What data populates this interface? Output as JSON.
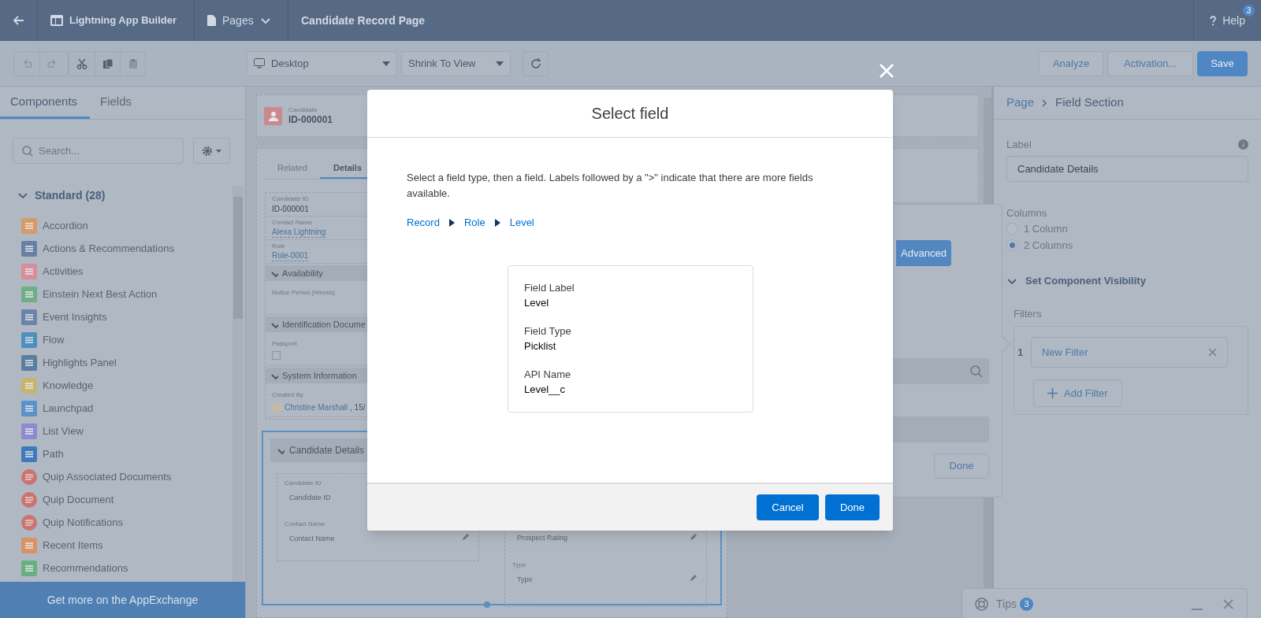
{
  "top_bar": {
    "app_name": "Lightning App Builder",
    "pages_menu": "Pages",
    "page_title": "Candidate Record Page",
    "help": {
      "label": "Help",
      "badge": "3"
    }
  },
  "toolbar": {
    "device": "Desktop",
    "zoom": "Shrink To View",
    "buttons": [
      {
        "label": "Analyze",
        "kind": "neutral"
      },
      {
        "label": "Activation...",
        "kind": "neutral"
      },
      {
        "label": "Save",
        "kind": "brand"
      }
    ]
  },
  "left_panel": {
    "tabs": [
      {
        "label": "Components",
        "selected": true
      },
      {
        "label": "Fields",
        "selected": false
      }
    ],
    "search": {
      "placeholder": "Search..."
    },
    "group": {
      "label": "Standard (28)",
      "expanded": true
    },
    "components": [
      {
        "label": "Accordion",
        "kind": "tile",
        "color": "#d59a65"
      },
      {
        "label": "Actions & Recommendations",
        "kind": "tile",
        "color": "#6a7fa6"
      },
      {
        "label": "Activities",
        "kind": "tile",
        "color": "#d88d9a"
      },
      {
        "label": "Einstein Next Best Action",
        "kind": "tile",
        "color": "#6fae86"
      },
      {
        "label": "Event Insights",
        "kind": "tile",
        "color": "#6b84aa"
      },
      {
        "label": "Flow",
        "kind": "tile",
        "color": "#4d8fbd"
      },
      {
        "label": "Highlights Panel",
        "kind": "tile",
        "color": "#5a7e9e"
      },
      {
        "label": "Knowledge",
        "kind": "tile",
        "color": "#c6b46f"
      },
      {
        "label": "Launchpad",
        "kind": "tile",
        "color": "#5a93c9"
      },
      {
        "label": "List View",
        "kind": "tile",
        "color": "#8c8bd0"
      },
      {
        "label": "Path",
        "kind": "tile",
        "color": "#3e7bbd"
      },
      {
        "label": "Quip Associated Documents",
        "kind": "bubble",
        "color": "#c97470"
      },
      {
        "label": "Quip Document",
        "kind": "bubble",
        "color": "#c97470"
      },
      {
        "label": "Quip Notifications",
        "kind": "bubble",
        "color": "#c97470"
      },
      {
        "label": "Recent Items",
        "kind": "tile",
        "color": "#d99266"
      },
      {
        "label": "Recommendations",
        "kind": "tile",
        "color": "#6aaf82"
      }
    ],
    "footer": "Get more on the AppExchange"
  },
  "canvas": {
    "record_header": {
      "object": "Candidate",
      "record": "ID-000001"
    },
    "tabs": [
      {
        "label": "Related",
        "selected": false
      },
      {
        "label": "Details",
        "selected": true
      }
    ],
    "fields": [
      {
        "label": "Candidate ID",
        "value": "ID-000001",
        "kind": "text"
      },
      {
        "label": "Contact Name",
        "value": "Alexa Lightning",
        "kind": "link"
      },
      {
        "label": "Role",
        "value": "Role-0001",
        "kind": "link"
      }
    ],
    "sections": [
      {
        "title": "Availability",
        "expanded": true,
        "fields": [
          {
            "label": "Notice Period (Weeks)",
            "kind": "empty"
          }
        ]
      },
      {
        "title": "Identification Docume",
        "expanded": true,
        "fields": [
          {
            "label": "Passport",
            "kind": "checkbox",
            "checked": false
          }
        ]
      },
      {
        "title": "System Information",
        "expanded": true,
        "fields": [
          {
            "label": "Created By",
            "kind": "user",
            "value": "Christine Marshall",
            "suffix": ", 15/"
          }
        ]
      }
    ],
    "selected_section": {
      "title": "Candidate Details",
      "expanded": true,
      "columns": [
        [
          {
            "label": "Candidate ID",
            "placeholder": "Candidate ID"
          },
          {
            "label": "Contact Name",
            "placeholder": "Contact Name"
          }
        ],
        [
          {
            "placeholder": "Prospect Rating"
          },
          {
            "label": "Type",
            "placeholder": "Type"
          }
        ]
      ]
    }
  },
  "popover": {
    "advanced_button": "Advanced",
    "done_button": "Done"
  },
  "modal": {
    "title": "Select field",
    "description": "Select a field type, then a field. Labels followed by a \">\" indicate that there are more fields available.",
    "path": [
      {
        "label": "Record"
      },
      {
        "label": "Role"
      },
      {
        "label": "Level"
      }
    ],
    "details": [
      {
        "label": "Field Label",
        "value": "Level"
      },
      {
        "label": "Field Type",
        "value": "Picklist"
      },
      {
        "label": "API Name",
        "value": "Level__c"
      }
    ],
    "buttons": [
      {
        "label": "Cancel"
      },
      {
        "label": "Done"
      }
    ]
  },
  "right_panel": {
    "breadcrumb": [
      "Page",
      "Field Section"
    ],
    "label_field": {
      "label": "Label",
      "value": "Candidate Details"
    },
    "columns": {
      "label": "Columns",
      "options": [
        {
          "label": "1 Column",
          "selected": false
        },
        {
          "label": "2 Columns",
          "selected": true
        }
      ]
    },
    "visibility": {
      "title": "Set Component Visibility",
      "expanded": true,
      "filters_label": "Filters",
      "filters": [
        {
          "number": "1",
          "label": "New Filter"
        }
      ],
      "add_button": "Add Filter"
    }
  },
  "tips": {
    "label": "Tips",
    "badge": "3"
  }
}
